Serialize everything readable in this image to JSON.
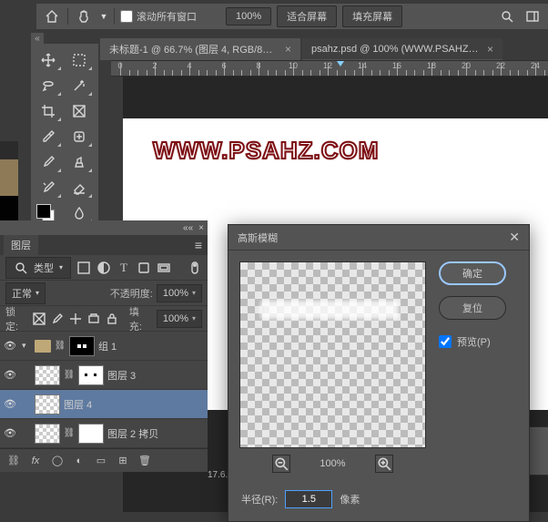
{
  "topbar": {
    "scroll_all_windows": "滚动所有窗口",
    "zoom_value": "100%",
    "fit_screen": "适合屏幕",
    "fill_screen": "填充屏幕"
  },
  "tabs": {
    "active": "未标题-1 @ 66.7% (图层 4, RGB/8#) *",
    "inactive": "psahz.psd @ 100% (WWW.PSAHZ.CO..."
  },
  "ruler": {
    "ticks": [
      "0",
      "2",
      "4",
      "6",
      "8",
      "10",
      "12",
      "14",
      "16",
      "18",
      "20",
      "22",
      "24"
    ]
  },
  "canvas": {
    "watermark": "WWW.PSAHZ.COM"
  },
  "layers_panel": {
    "tab": "图层",
    "kind": "类型",
    "blend_label": "正常",
    "opacity_label": "不透明度:",
    "opacity_value": "100%",
    "lock_label": "锁定:",
    "fill_label": "填充:",
    "fill_value": "100%",
    "group_name": "组 1",
    "layers": [
      {
        "name": "图层 3"
      },
      {
        "name": "图层 4"
      },
      {
        "name": "图层 2 拷贝"
      }
    ]
  },
  "status": {
    "doc_size": "17.6..."
  },
  "dialog": {
    "title": "高斯模糊",
    "ok": "确定",
    "reset": "复位",
    "preview": "预览(P)",
    "zoom": "100%",
    "radius_label": "半径(R):",
    "radius_value": "1.5",
    "radius_unit": "像素"
  }
}
